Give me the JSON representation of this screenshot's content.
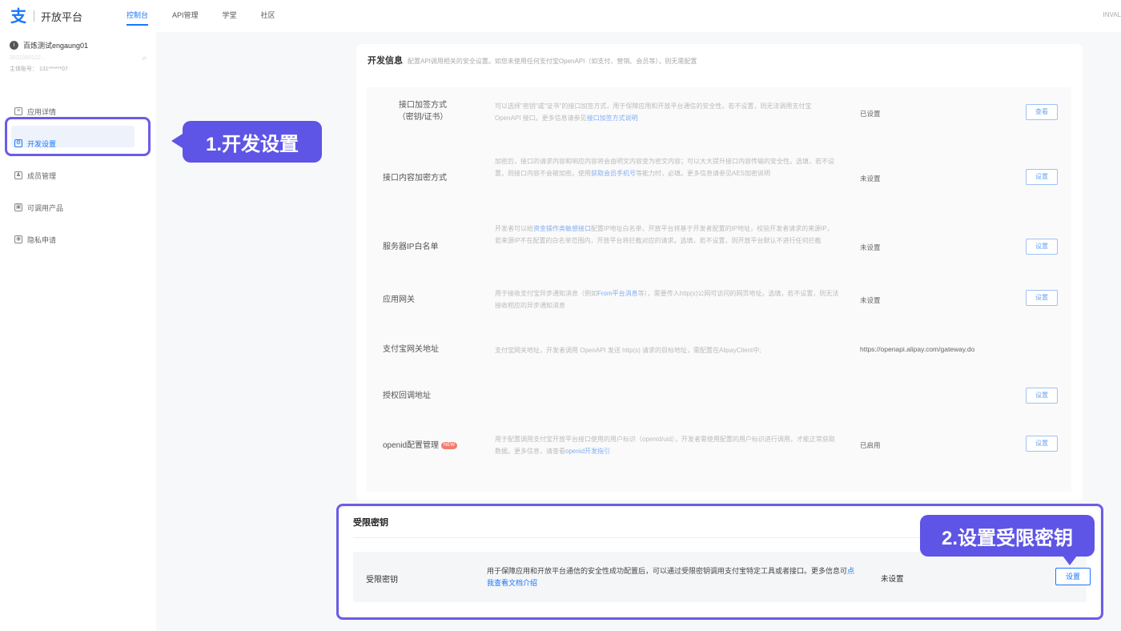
{
  "header": {
    "logo_glyph": "支",
    "brand": "开放平台",
    "tabs": [
      "控制台",
      "API管理",
      "学堂",
      "社区"
    ],
    "active_tab": 0,
    "right_text": "INVAL"
  },
  "sidebar": {
    "user_name": "百炼测试engaung01",
    "user_avatar_glyph": "i",
    "user_sub": "2021000122...",
    "account_label": "主体账号：",
    "account_value": "131******07",
    "items": [
      {
        "label": "应用详情",
        "icon": "app-detail-icon",
        "glyph": "≡"
      },
      {
        "label": "开发设置",
        "icon": "dev-settings-icon",
        "glyph": "⚙"
      },
      {
        "label": "成员管理",
        "icon": "member-icon",
        "glyph": "♟"
      },
      {
        "label": "可调用产品",
        "icon": "product-icon",
        "glyph": "▣"
      },
      {
        "label": "隐私申请",
        "icon": "privacy-icon",
        "glyph": "◉"
      }
    ],
    "active_index": 1
  },
  "callouts": {
    "step1": "1.开发设置",
    "step2": "2.设置受限密钥"
  },
  "dev_info": {
    "title": "开发信息",
    "desc": "配置API调用相关的安全设置。如您未使用任何支付宝OpenAPI（如支付、营销、会员等），则无需配置",
    "rows": [
      {
        "label_line1": "接口加签方式",
        "label_line2": "（密钥/证书）",
        "desc_pre": "可以选择\"密钥\"或\"证书\"的接口加签方式，用于保障应用和开放平台通信的安全性。若不设置，则无法调用支付宝 OpenAPI 接口。更多信息请参见",
        "desc_link": "接口加签方式说明",
        "desc_post": "",
        "status": "已设置",
        "button": "查看"
      },
      {
        "label_line1": "接口内容加密方式",
        "label_line2": "",
        "desc_pre": "加密后，接口的请求内容和响应内容将会由明文内容变为密文内容；可以大大提升接口内容传输的安全性。选填，若不设置，则接口内容不会被加密。使用",
        "desc_link": "获取会员手机号",
        "desc_post": "等能力时，必填。更多信息请参见AES加密说明",
        "status": "未设置",
        "button": "设置"
      },
      {
        "label_line1": "服务器IP白名单",
        "label_line2": "",
        "desc_pre": "开发者可以给",
        "desc_link": "资金操作类敏感接口",
        "desc_post": "配置IP地址白名单，开放平台将基于开发者配置的IP地址，校验开发者请求的来源IP，若来源IP不在配置的白名单范围内，开放平台将拦截对应的请求。选填，若不设置，则开放平台默认不进行任何拦截",
        "status": "未设置",
        "button": "设置"
      },
      {
        "label_line1": "应用网关",
        "label_line2": "",
        "desc_pre": "用于接收支付宝异步通知消息（例如",
        "desc_link": "From平台消息",
        "desc_post": "等），需要传入http(s)公网可访问的网页地址。选填，若不设置，则无法接收相应的异步通知消息",
        "status": "未设置",
        "button": "设置"
      },
      {
        "label_line1": "支付宝网关地址",
        "label_line2": "",
        "desc_pre": "支付宝网关地址，开发者调用 OpenAPI 发送 http(s) 请求的目标地址，需配置在AlipayClient中;",
        "desc_link": "",
        "desc_post": "",
        "status": "https://openapi.alipay.com/gateway.do",
        "button": ""
      },
      {
        "label_line1": "授权回调地址",
        "label_line2": "",
        "desc_pre": "",
        "desc_link": "",
        "desc_post": "",
        "status": "",
        "button": "设置"
      },
      {
        "label_line1": "openid配置管理",
        "label_line2": "",
        "badge": "NEW",
        "desc_pre": "用于配置调用支付宝开放平台接口使用的用户标识（openid/uid），开发者需使用配置的用户标识进行调用，才能正常获取数据。更多信息，请查看",
        "desc_link": "openid开发指引",
        "desc_post": "",
        "status": "已启用",
        "button": "设置"
      }
    ]
  },
  "restricted_key": {
    "title": "受限密钥",
    "label": "受限密钥",
    "desc_pre": "用于保障应用和开放平台通信的安全性成功配置后，可以通过受限密钥调用支付宝特定工具或者接口。更多信息可",
    "desc_link": "点我查看文档介绍",
    "status": "未设置",
    "button": "设置"
  },
  "colors": {
    "accent": "#1677ff",
    "callout": "#5e55e6"
  }
}
